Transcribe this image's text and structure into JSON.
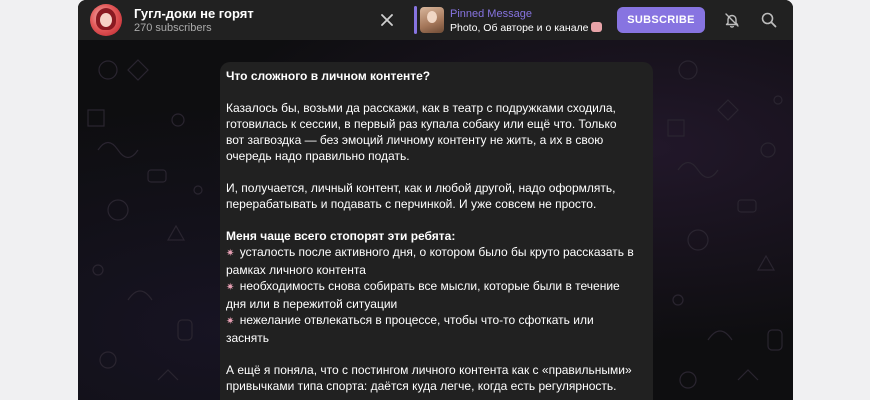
{
  "channel": {
    "title": "Гугл-доки не горят",
    "subscribers": "270 subscribers"
  },
  "pinned": {
    "title": "Pinned Message",
    "text": "Photo, Об авторе и о канале"
  },
  "header": {
    "subscribe_label": "SUBSCRIBE",
    "close_icon": "close-icon",
    "bell_icon": "bell-off-icon",
    "search_icon": "search-icon"
  },
  "colors": {
    "accent": "#8774e1",
    "bubble": "#212121",
    "header": "#212121",
    "background": "#0e0e10"
  },
  "message": {
    "heading": "Что сложного в личном контенте?",
    "p1_l1": "Казалось бы, возьми да расскажи, как в театр с подружками сходила,",
    "p1_l2": "готовилась к сессии, в первый раз купала собаку или ещё что. Только",
    "p1_l3": "вот загвоздка — без эмоций личному контенту не жить, а их в свою",
    "p1_l4": "очередь надо правильно подать.",
    "p2_l1": "И, получается, личный контент, как и любой другой, надо оформлять,",
    "p2_l2": "перерабатывать и подавать с перчинкой. И уже совсем не просто.",
    "list_heading": "Меня чаще всего стопорят эти ребята:",
    "bullet": "✷",
    "i1_l1": "усталость после активного дня, о котором было бы круто рассказать в",
    "i1_l2": "рамках личного контента",
    "i2_l1": "необходимость снова собирать все мысли, которые были в течение",
    "i2_l2": "дня или в пережитой ситуации",
    "i3_l1": "нежелание отвлекаться в процессе, чтобы что-то сфоткать или",
    "i3_l2": "заснять",
    "p3_l1": "А ещё я поняла, что с постингом личного контента как с «правильными»",
    "p3_l2": "привычками типа спорта: даётся куда легче, когда есть регулярность."
  }
}
